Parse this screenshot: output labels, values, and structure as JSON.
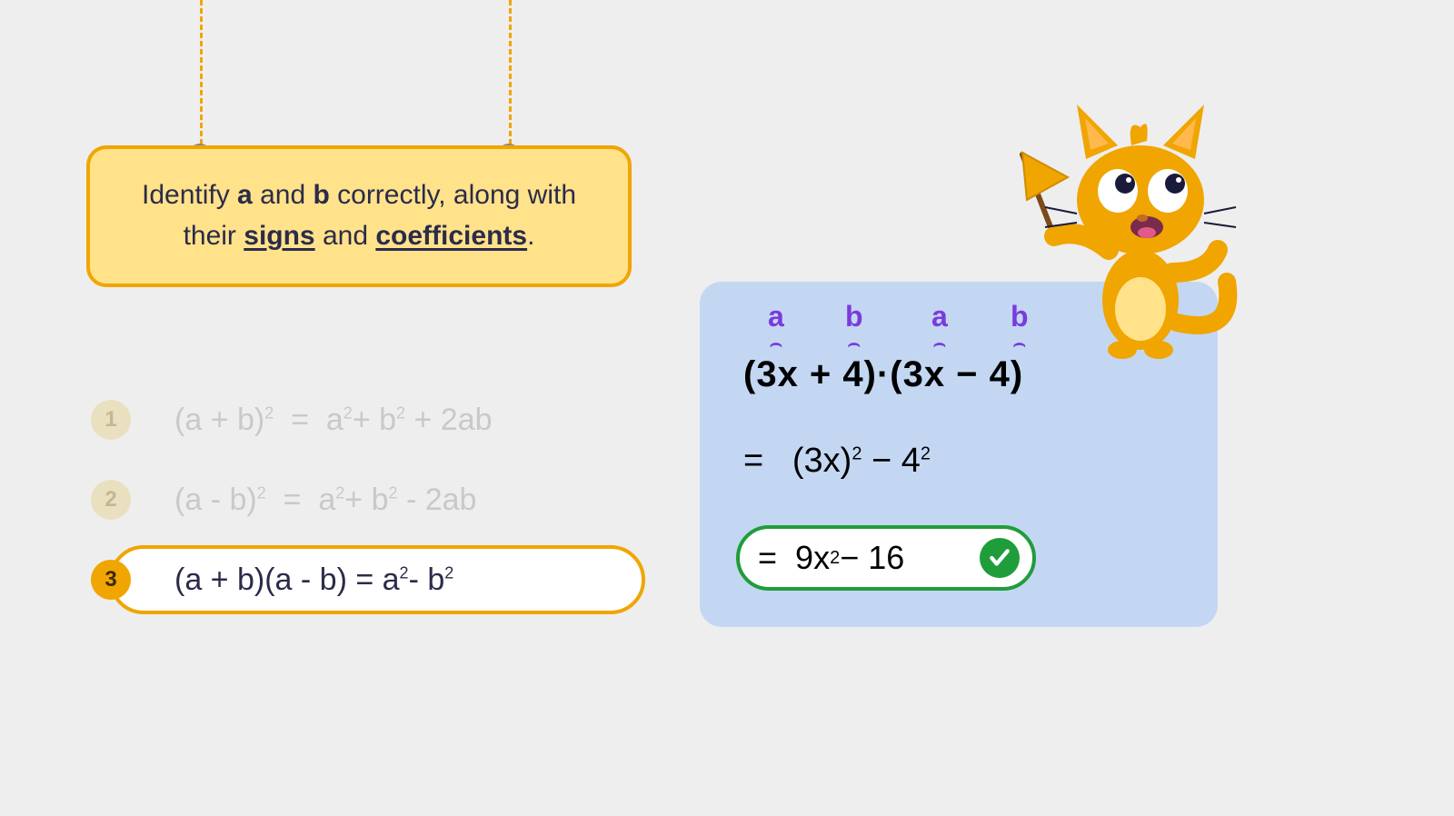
{
  "instruction": {
    "pre": "Identify ",
    "a": "a",
    "mid1": " and ",
    "b": "b",
    "mid2": " correctly, along with their ",
    "signs": "signs",
    "mid3": " and ",
    "coeffs": "coefficients",
    "post": "."
  },
  "formulas": {
    "items": [
      {
        "n": "1",
        "lhs": "(a + b)",
        "lhs_sup": "2",
        "rhs": "a",
        "rhs1_sup": "2",
        "plus1": "+ b",
        "rhs2_sup": "2",
        "tail": " + 2ab"
      },
      {
        "n": "2",
        "lhs": "(a - b)",
        "lhs_sup": "2",
        "rhs": "a",
        "rhs1_sup": "2",
        "plus1": "+ b",
        "rhs2_sup": "2",
        "tail": " - 2ab"
      },
      {
        "n": "3",
        "full": "(a + b)(a - b)  =  a",
        "sup1": "2",
        "mid": "- b",
        "sup2": "2"
      }
    ]
  },
  "work": {
    "labels": [
      "a",
      "b",
      "a",
      "b"
    ],
    "main": "(3x + 4)·(3x − 4)",
    "step_eq": "=",
    "step_lhs": "(3x)",
    "step_lhs_sup": "2",
    "step_mid": " − 4",
    "step_rhs_sup": "2",
    "answer_eq": "=",
    "answer_body": "9x",
    "answer_sup": "2",
    "answer_tail": " − 16"
  },
  "colors": {
    "accent": "#f0a500",
    "card": "#ffe28a",
    "panel": "#c3d7f3",
    "purple": "#7a3bdc",
    "green": "#1f9d3a",
    "text": "#2b2b4a"
  }
}
